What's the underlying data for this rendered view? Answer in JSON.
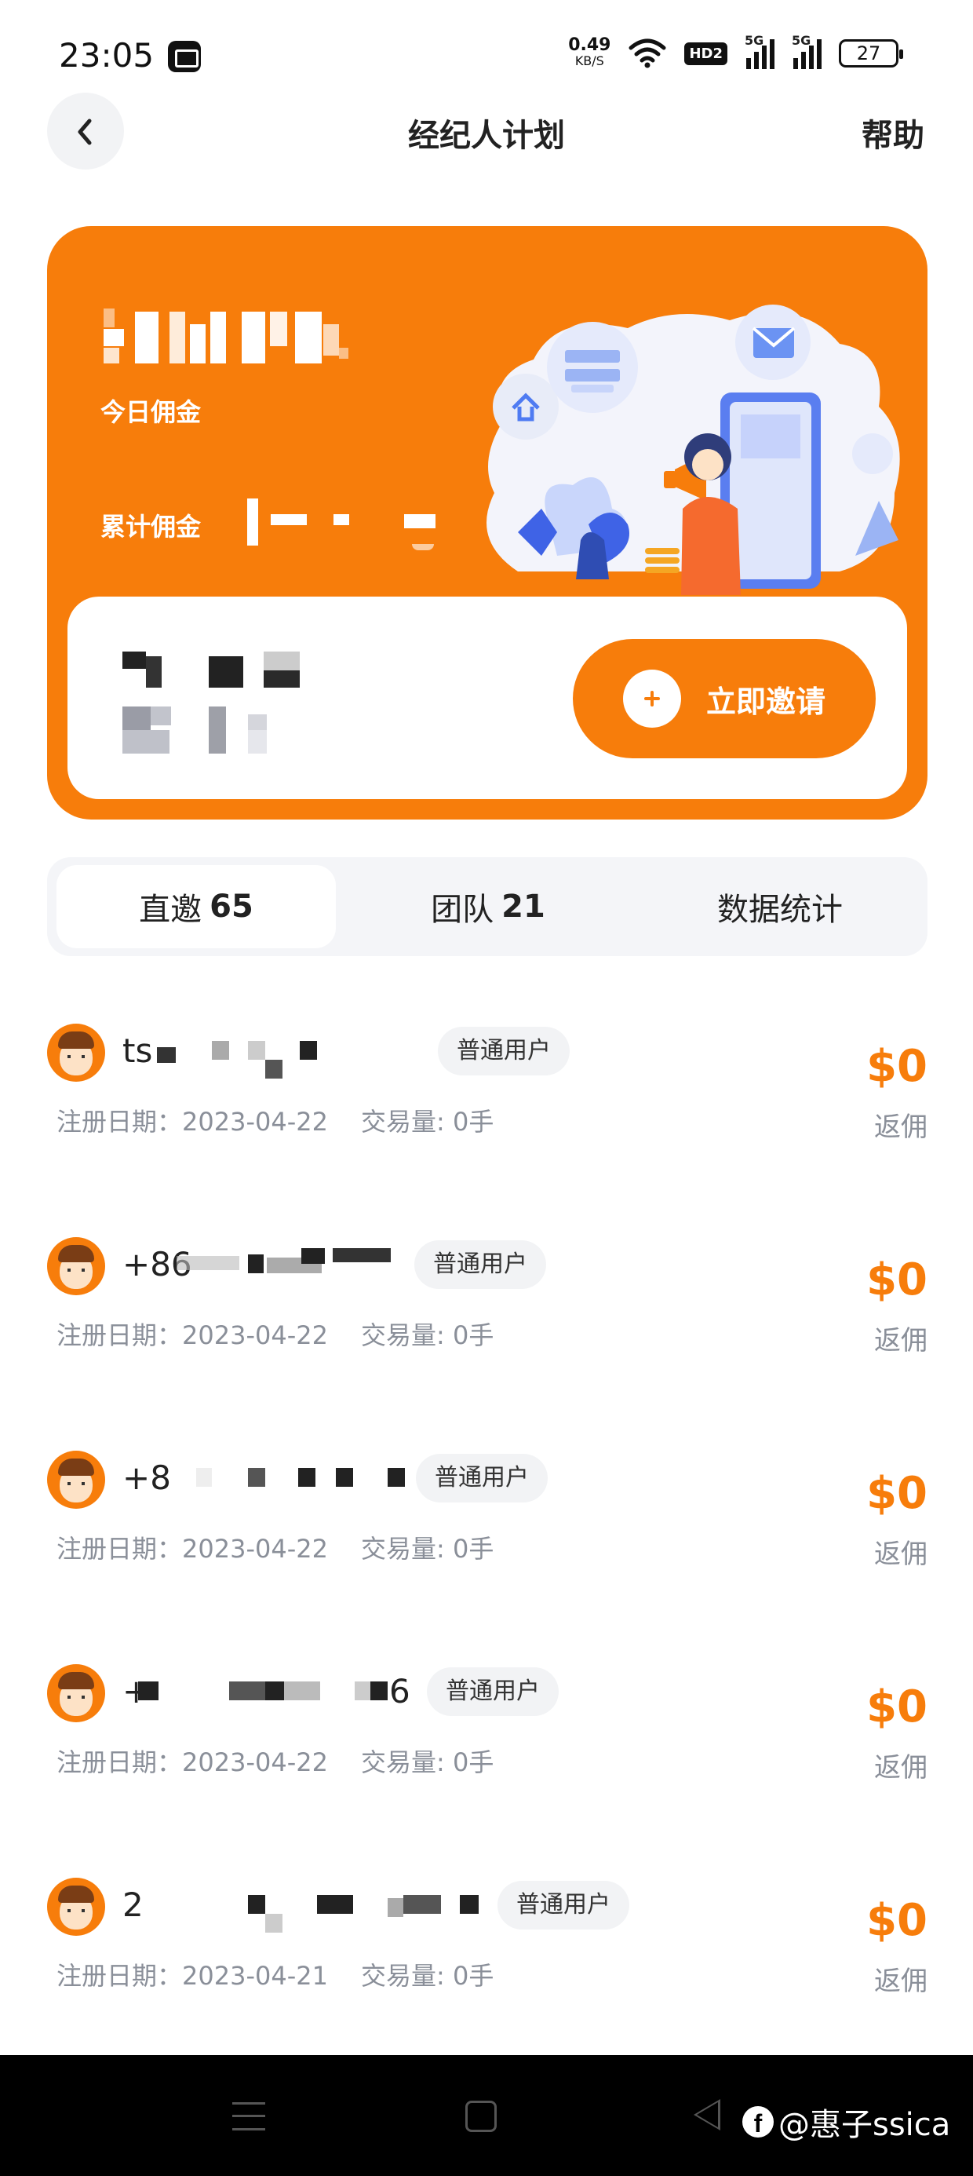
{
  "status_bar": {
    "time": "23:05",
    "net_speed": "0.49",
    "net_unit": "KB/S",
    "hd_badge": "HD2",
    "sim1": "5G",
    "sim2": "5G",
    "battery": "27",
    "icons": [
      "mail-icon",
      "wifi-icon",
      "signal-icon",
      "battery-icon"
    ]
  },
  "header": {
    "title": "经纪人计划",
    "help": "帮助",
    "back_icon": "chevron-left-icon"
  },
  "hero": {
    "today_label": "今日佣金",
    "total_label": "累计佣金",
    "invite_button": "立即邀请",
    "accent_color": "#f77d0b"
  },
  "tabs": [
    {
      "label": "直邀",
      "count": "65",
      "active": true
    },
    {
      "label": "团队",
      "count": "21",
      "active": false
    },
    {
      "label": "数据统计",
      "count": "",
      "active": false
    }
  ],
  "list": {
    "tag": "普通用户",
    "date_prefix": "注册日期：",
    "volume_prefix": "交易量: ",
    "amount_label": "返佣",
    "rows": [
      {
        "name": "ts",
        "date": "2023-04-22",
        "volume": "0手",
        "amount": "$0"
      },
      {
        "name": "+86",
        "date": "2023-04-22",
        "volume": "0手",
        "amount": "$0"
      },
      {
        "name": "+8",
        "date": "2023-04-22",
        "volume": "0手",
        "amount": "$0"
      },
      {
        "name": "+",
        "date": "2023-04-22",
        "volume": "0手",
        "amount": "$0"
      },
      {
        "name": "2",
        "date": "2023-04-21",
        "volume": "0手",
        "amount": "$0"
      }
    ]
  },
  "watermark": {
    "logo": "f",
    "text": "@惠子ssica"
  }
}
